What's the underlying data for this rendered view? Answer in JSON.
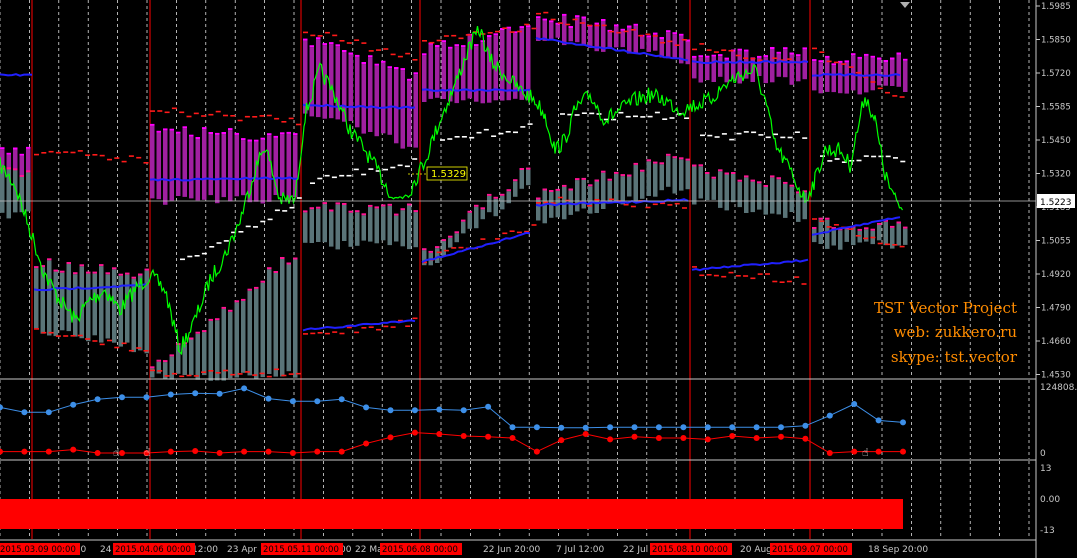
{
  "colors": {
    "background": "#000000",
    "axis": "#c8c8c8",
    "grid": "#ffffff",
    "session_lines": "#ff0000",
    "price_line": "#00ff00",
    "vector_purple": "#a020a0",
    "vector_gray": "#5a7478",
    "mid_line": "#2020ff",
    "dash_red": "#ff1a1a",
    "indicator_blue": "#3d8fe8",
    "indicator_red": "#ff0000",
    "watermark": "#ff8c00",
    "price_label_box": "#ffff00"
  },
  "main_panel": {
    "price_axis_labels": [
      "1.5985",
      "1.5850",
      "1.5720",
      "1.5585",
      "1.5450",
      "1.5320",
      "1.5185",
      "1.5055",
      "1.4920",
      "1.4790",
      "1.4660",
      "1.4530"
    ],
    "current_price_label": "1.5223",
    "marker_price_label": "1.5329",
    "watermark_lines": [
      "TST Vector Project",
      "web: zukkero.ru",
      "skype: tst.vector"
    ]
  },
  "indicator_panel_1": {
    "axis_labels": [
      "124808.2",
      "0"
    ],
    "blue_series": [
      0.67,
      0.6,
      0.6,
      0.71,
      0.79,
      0.82,
      0.82,
      0.86,
      0.88,
      0.87,
      0.95,
      0.8,
      0.76,
      0.76,
      0.79,
      0.67,
      0.63,
      0.63,
      0.64,
      0.63,
      0.68,
      0.38,
      0.38,
      0.37,
      0.37,
      0.38,
      0.38,
      0.38,
      0.38,
      0.38,
      0.38,
      0.38,
      0.38,
      0.4,
      0.55,
      0.72,
      0.48,
      0.45
    ],
    "red_series": [
      0.02,
      0.02,
      0.02,
      0.05,
      0.0,
      0.0,
      0.0,
      0.02,
      0.03,
      0.0,
      0.02,
      0.02,
      0.0,
      0.02,
      0.02,
      0.14,
      0.23,
      0.3,
      0.28,
      0.25,
      0.24,
      0.22,
      0.02,
      0.19,
      0.28,
      0.2,
      0.24,
      0.22,
      0.22,
      0.2,
      0.25,
      0.22,
      0.24,
      0.21,
      0.0,
      0.02,
      0.02,
      0.02
    ]
  },
  "indicator_panel_2": {
    "axis_labels": [
      "13",
      "0.00",
      "-13"
    ],
    "bar_value": -13
  },
  "time_axis": {
    "labels": [
      "4:00",
      "24",
      "12:00",
      "23 Apr",
      "00",
      "22 Ma",
      "22 Jun 20:00",
      "7 Jul 12:00",
      "22 Jul 04",
      "20 Aug",
      "18 Sep 20:00"
    ],
    "highlighted_labels": [
      "2015.03.09 00:00",
      "2015.04.06 00:00",
      "2015.05.11 00:00",
      "2015.06.08 00:00",
      "2015.08.10 00:00",
      "2015.09.07 00:00"
    ]
  }
}
